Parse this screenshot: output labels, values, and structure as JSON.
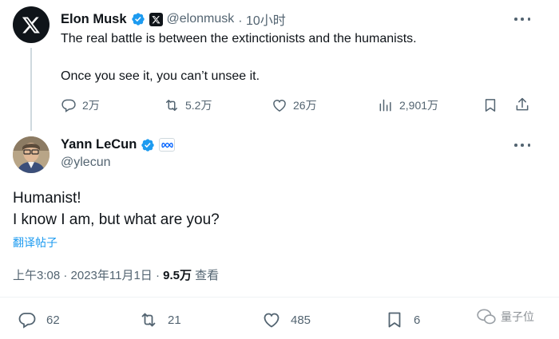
{
  "tweet1": {
    "name": "Elon Musk",
    "handle": "@elonmusk",
    "time": "· 10小时",
    "line1": "The real battle is between the extinctionists and the humanists.",
    "line2": "Once you see it, you can’t unsee it.",
    "replies": "2万",
    "reposts": "5.2万",
    "likes": "26万",
    "views": "2,901万"
  },
  "tweet2": {
    "name": "Yann LeCun",
    "handle": "@ylecun",
    "line1": "Humanist!",
    "line2": "I know I am, but what are you?",
    "translate": "翻译帖子",
    "timestamp": "上午3:08 · 2023年11月1日 · ",
    "views_count": "9.5万",
    "views_label": " 查看",
    "replies": "62",
    "reposts": "21",
    "likes": "485",
    "bookmarks": "6"
  },
  "watermark": {
    "text": "量子位"
  },
  "icons": {
    "reply": "reply-icon",
    "repost": "repost-icon",
    "like": "like-icon",
    "views": "views-icon",
    "bookmark": "bookmark-icon",
    "share": "share-icon",
    "more": "more-icon",
    "verified": "verified-icon",
    "x_logo": "x-logo-icon",
    "meta": "meta-icon"
  },
  "colors": {
    "text": "#0f1419",
    "muted": "#536471",
    "verified": "#1d9bf0",
    "link": "#1d9bf0"
  }
}
